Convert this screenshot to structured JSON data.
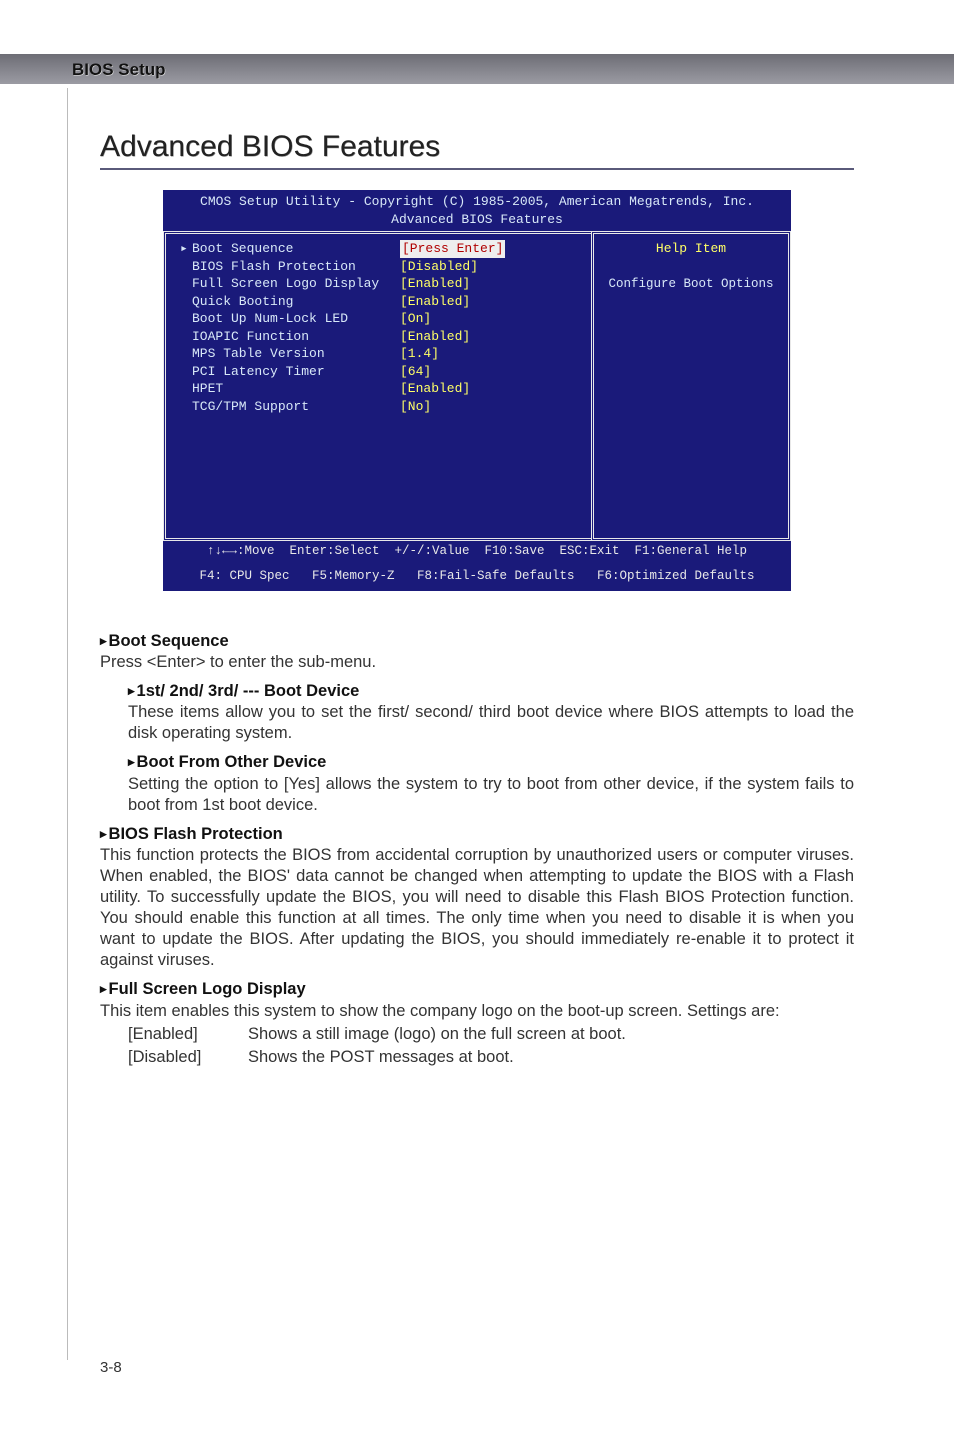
{
  "header": {
    "title": "BIOS Setup"
  },
  "page_title": "Advanced BIOS Features",
  "bios": {
    "title": "CMOS Setup Utility - Copyright (C) 1985-2005, American Megatrends, Inc.",
    "subtitle": "Advanced BIOS Features",
    "items": [
      {
        "label": "Boot Sequence",
        "value": "[Press Enter]",
        "arrow": true,
        "selected": true
      },
      {
        "label": "BIOS Flash Protection",
        "value": "[Disabled]"
      },
      {
        "label": "Full Screen Logo Display",
        "value": "[Enabled]"
      },
      {
        "label": "Quick Booting",
        "value": "[Enabled]"
      },
      {
        "label": "Boot Up Num-Lock LED",
        "value": "[On]"
      },
      {
        "label": "IOAPIC Function",
        "value": "[Enabled]"
      },
      {
        "label": "MPS Table Version",
        "value": "[1.4]"
      },
      {
        "label": "PCI Latency Timer",
        "value": "[64]"
      },
      {
        "label": "HPET",
        "value": "[Enabled]"
      },
      {
        "label": "TCG/TPM Support",
        "value": "[No]"
      }
    ],
    "help_title": "Help Item",
    "help_desc": "Configure Boot Options",
    "footer1": "↑↓←→:Move  Enter:Select  +/-/:Value  F10:Save  ESC:Exit  F1:General Help",
    "footer2": "F4: CPU Spec   F5:Memory-Z   F8:Fail-Safe Defaults   F6:Optimized Defaults"
  },
  "doc": {
    "boot_seq": {
      "heading": "Boot Sequence",
      "body": "Press <Enter> to enter the sub-menu.",
      "sub1_h": "1st/ 2nd/ 3rd/ --- Boot Device",
      "sub1_b": "These items allow you to set the first/ second/ third boot device where BIOS attempts to load the disk operating system.",
      "sub2_h": "Boot From Other Device",
      "sub2_b": "Setting the option to [Yes] allows the system to try to boot from other device, if the system fails to boot from 1st boot device."
    },
    "flash": {
      "heading": "BIOS Flash Protection",
      "body": "This function protects the BIOS from accidental corruption by unauthorized users or computer viruses. When enabled, the BIOS' data cannot be changed when attempting to update the BIOS with a Flash utility. To successfully update the BIOS, you will need to disable this Flash BIOS Protection function. You should enable this function at all times. The only time when you need to disable it is when you want to update the BIOS. After updating the BIOS, you should immediately re-enable it to protect it against viruses."
    },
    "logo": {
      "heading": "Full Screen Logo Display",
      "body": "This item enables this system to show the company logo on the boot-up screen. Settings are:",
      "settings": [
        {
          "key": "[Enabled]",
          "val": "Shows a still image (logo) on the full screen at boot."
        },
        {
          "key": "[Disabled]",
          "val": "Shows the POST messages at boot."
        }
      ]
    }
  },
  "page_num": "3-8"
}
